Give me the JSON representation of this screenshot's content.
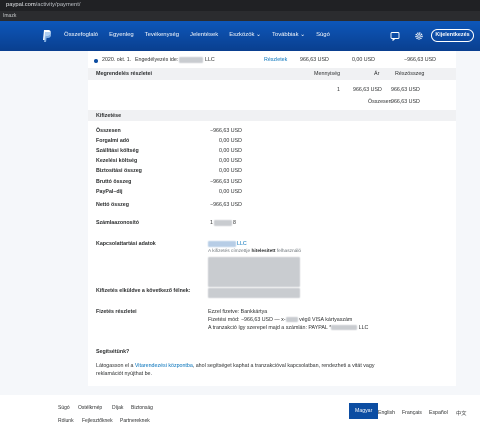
{
  "browser": {
    "url_domain": "paypal.com",
    "url_path": "/activity/payment/"
  },
  "bookmarks": {
    "label": "Imazk"
  },
  "nav": {
    "items": [
      "Összefoglaló",
      "Egyenleg",
      "Tevékenység",
      "Jelentések",
      "Eszközök ⌄",
      "Továbbiak ⌄",
      "Súgó"
    ],
    "logout": "Kijelentkezés"
  },
  "top_row": {
    "date": "2020. okt. 1.",
    "auth_prefix": "Engedélyezés ide:",
    "auth_suffix": "LLC",
    "details": "Részletek",
    "amount1": "966,63 USD",
    "amount2": "0,00 USD",
    "amount3": "−966,63 USD"
  },
  "order": {
    "title": "Megrendelés részletei",
    "col_qty": "Mennyiség",
    "col_price": "Ár",
    "col_sub": "Részösszeg",
    "qty": "1",
    "price": "966,63 USD",
    "sub": "966,63 USD",
    "total_label": "Összesen",
    "total": "966,63 USD"
  },
  "payment": {
    "title": "Kifizetése",
    "rows": [
      {
        "label": "Összesen",
        "value": "−966,63 USD"
      },
      {
        "label": "Forgalmi adó",
        "value": "0,00 USD"
      },
      {
        "label": "Szállítási költség",
        "value": "0,00 USD"
      },
      {
        "label": "Kezelési költség",
        "value": "0,00 USD"
      },
      {
        "label": "Biztosítási összeg",
        "value": "0,00 USD"
      },
      {
        "label": "Bruttó összeg",
        "value": "−966,63 USD"
      },
      {
        "label": "PayPal–díj",
        "value": "0,00 USD"
      },
      {
        "label": "Nettó összeg",
        "value": "−966,63 USD"
      }
    ]
  },
  "invoice": {
    "label": "Számlaazonosító",
    "prefix": "1",
    "suffix": "8"
  },
  "contact": {
    "label": "Kapcsolattartási adatok",
    "name_suffix": "LLC",
    "verified_pre": "A kifizetés címzettje",
    "verified_bold": "hitelesített",
    "verified_post": "felhasználó"
  },
  "shipping": {
    "label": "Kifizetés elküldve a következő félnek:"
  },
  "payment_details": {
    "label": "Fizetés részletei",
    "line1": "Ezzel fizetve: Bankkártya",
    "line2_pre": "Fizetési mód: −966,63 USD — x-",
    "line2_post": "végű VISA kártyaszám",
    "line3_pre": "A tranzakció így szerepel majd a számlán: PAYPAL *",
    "line3_post": "LLC"
  },
  "help": {
    "title": "Segítsétünk?",
    "text_pre": "Látogasson el a ",
    "link": "Vitarendezési központba",
    "text_post": ", ahol segítséget kaphat a tranzakcióval kapcsolatban, rendezheti a vitát vagy",
    "line2": "reklamációt nyújthat be."
  },
  "footer": {
    "links": [
      "Súgó",
      "Ostélkrnép",
      "Díjak",
      "Biztonság",
      "Rólunk",
      "Fejlesztőknek",
      "Partnereknek"
    ],
    "languages": [
      "Magyar",
      "English",
      "Français",
      "Español",
      "中文"
    ]
  }
}
